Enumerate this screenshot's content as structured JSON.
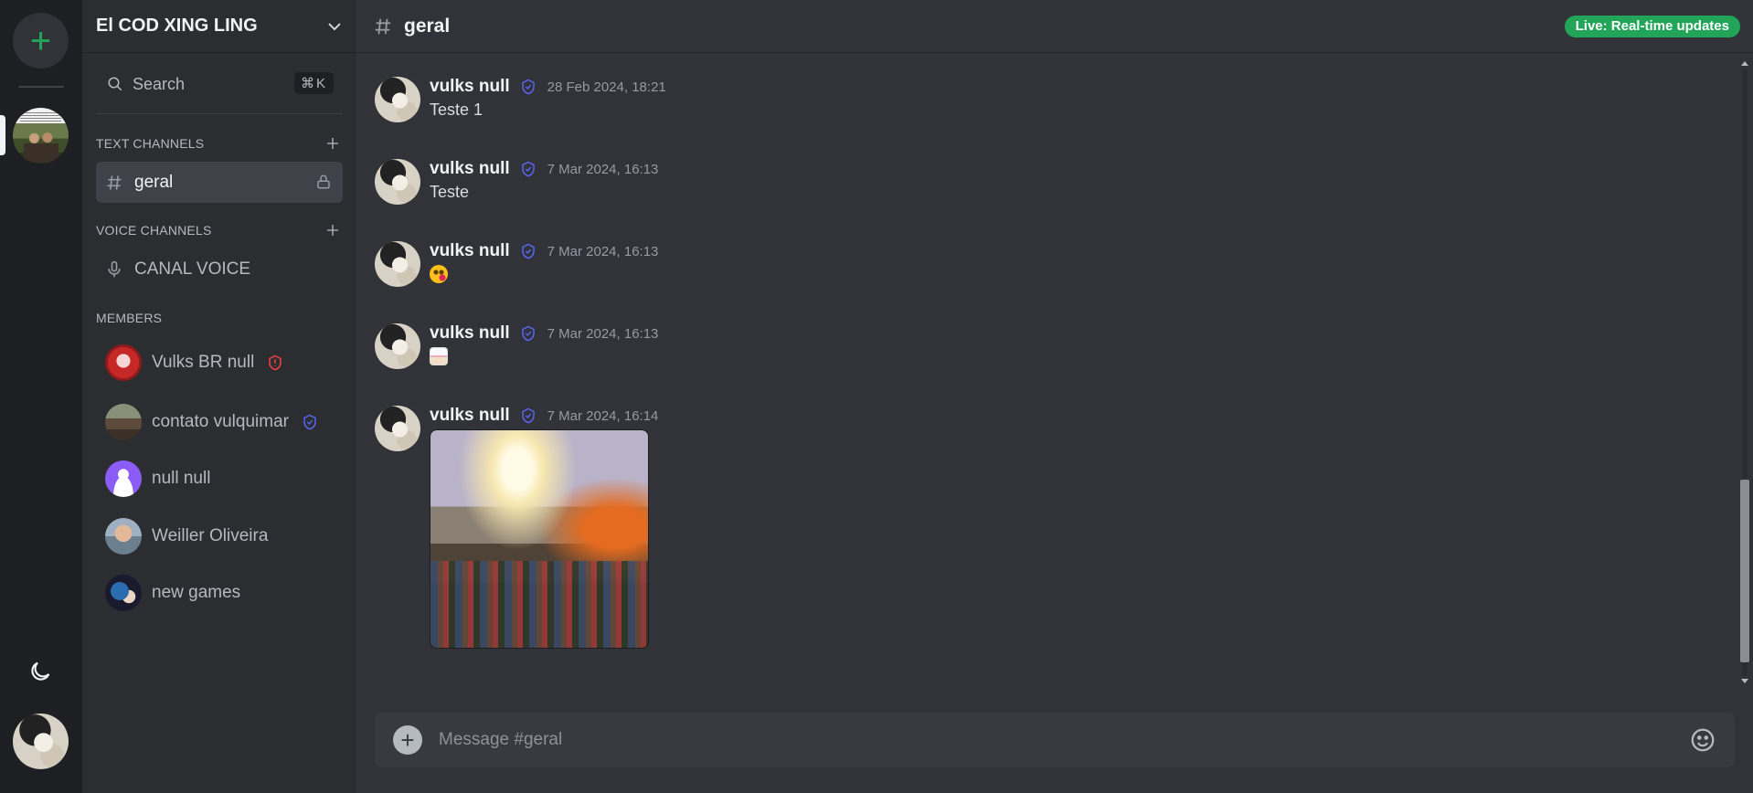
{
  "server": {
    "name": "El COD XING LING",
    "search_label": "Search",
    "search_shortcut": "⌘K"
  },
  "sections": {
    "text_channels": "TEXT CHANNELS",
    "voice_channels": "VOICE CHANNELS",
    "members": "MEMBERS"
  },
  "channels": {
    "text": [
      {
        "name": "geral",
        "locked": true,
        "active": true
      }
    ],
    "voice": [
      {
        "name": "CANAL VOICE"
      }
    ]
  },
  "members": [
    {
      "name": "Vulks BR null",
      "badge": "admin-shield-icon",
      "badge_color": "#f23f43"
    },
    {
      "name": "contato vulquimar",
      "badge": "verified-shield-icon",
      "badge_color": "#5865f2"
    },
    {
      "name": "null null"
    },
    {
      "name": "Weiller Oliveira"
    },
    {
      "name": "new games"
    }
  ],
  "channel_header": {
    "title": "geral",
    "live_badge": "Live: Real-time updates"
  },
  "messages": [
    {
      "author": "vulks null",
      "time": "28 Feb 2024, 18:21",
      "content": "Teste 1"
    },
    {
      "author": "vulks null",
      "time": "7 Mar 2024, 16:13",
      "content": "Teste"
    },
    {
      "author": "vulks null",
      "time": "7 Mar 2024, 16:13",
      "content": "",
      "emoji": "face-blowing-kiss"
    },
    {
      "author": "vulks null",
      "time": "7 Mar 2024, 16:13",
      "content": "",
      "emoji": "cake"
    },
    {
      "author": "vulks null",
      "time": "7 Mar 2024, 16:14",
      "content": "",
      "attachment": "image"
    }
  ],
  "composer": {
    "placeholder": "Message #geral"
  },
  "colors": {
    "accent_green": "#23a559",
    "verified_blue": "#5865f2",
    "admin_red": "#f23f43"
  }
}
